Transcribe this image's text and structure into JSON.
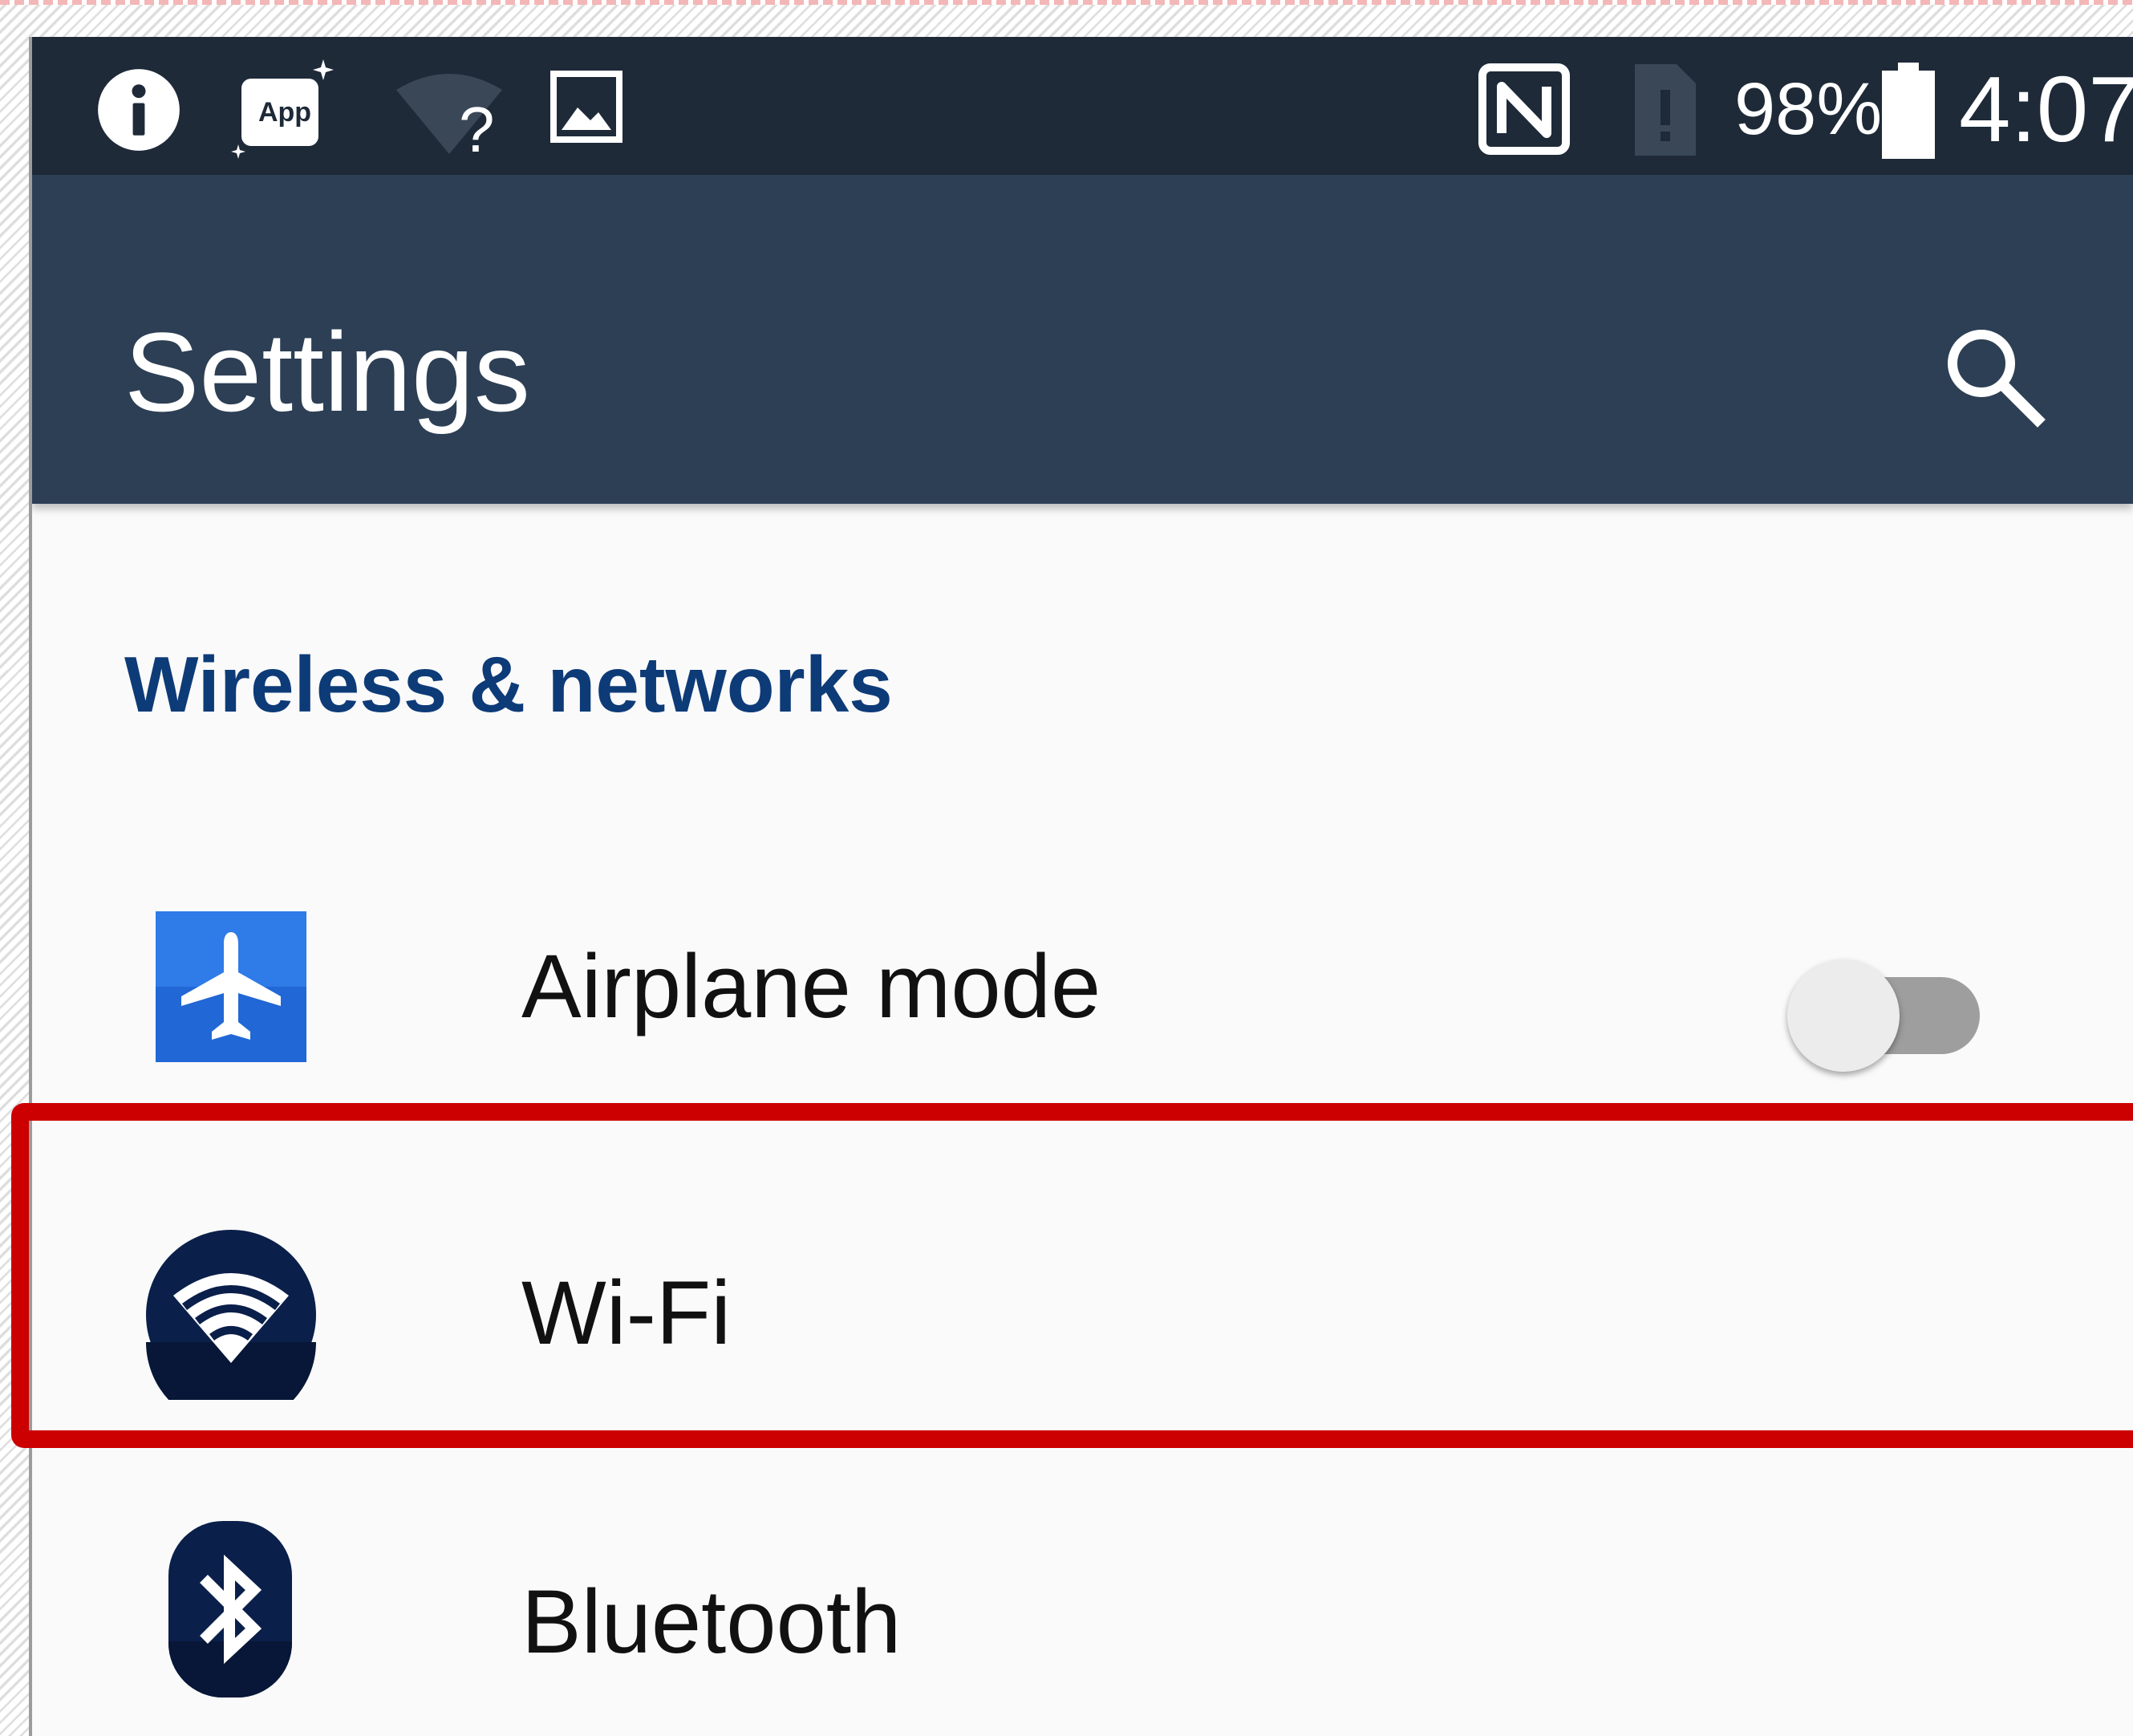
{
  "status_bar": {
    "app_icon_label": "App",
    "wifi_unknown_glyph": "?",
    "battery_percent": "98%",
    "time": "4:07",
    "icons": [
      "info-icon",
      "app-update-icon",
      "wifi-unknown-icon",
      "image-icon",
      "nfc-icon",
      "sim-alert-icon",
      "battery-icon"
    ]
  },
  "app_bar": {
    "title": "Settings",
    "search_icon": "search-icon"
  },
  "section": {
    "title": "Wireless & networks"
  },
  "items": [
    {
      "label": "Airplane mode",
      "icon": "airplane-icon",
      "toggle_on": false
    },
    {
      "label": "Wi-Fi",
      "icon": "wifi-icon",
      "highlighted": true
    },
    {
      "label": "Bluetooth",
      "icon": "bluetooth-icon"
    }
  ],
  "colors": {
    "status_bar_bg": "#1e2a38",
    "app_bar_bg": "#2d3f55",
    "section_header": "#0d3b78",
    "highlight_border": "#cc0000",
    "airplane_icon_bg": "#2f7be8",
    "wifi_icon_bg": "#0a1f4a",
    "bluetooth_icon_bg": "#0a1f4a"
  }
}
